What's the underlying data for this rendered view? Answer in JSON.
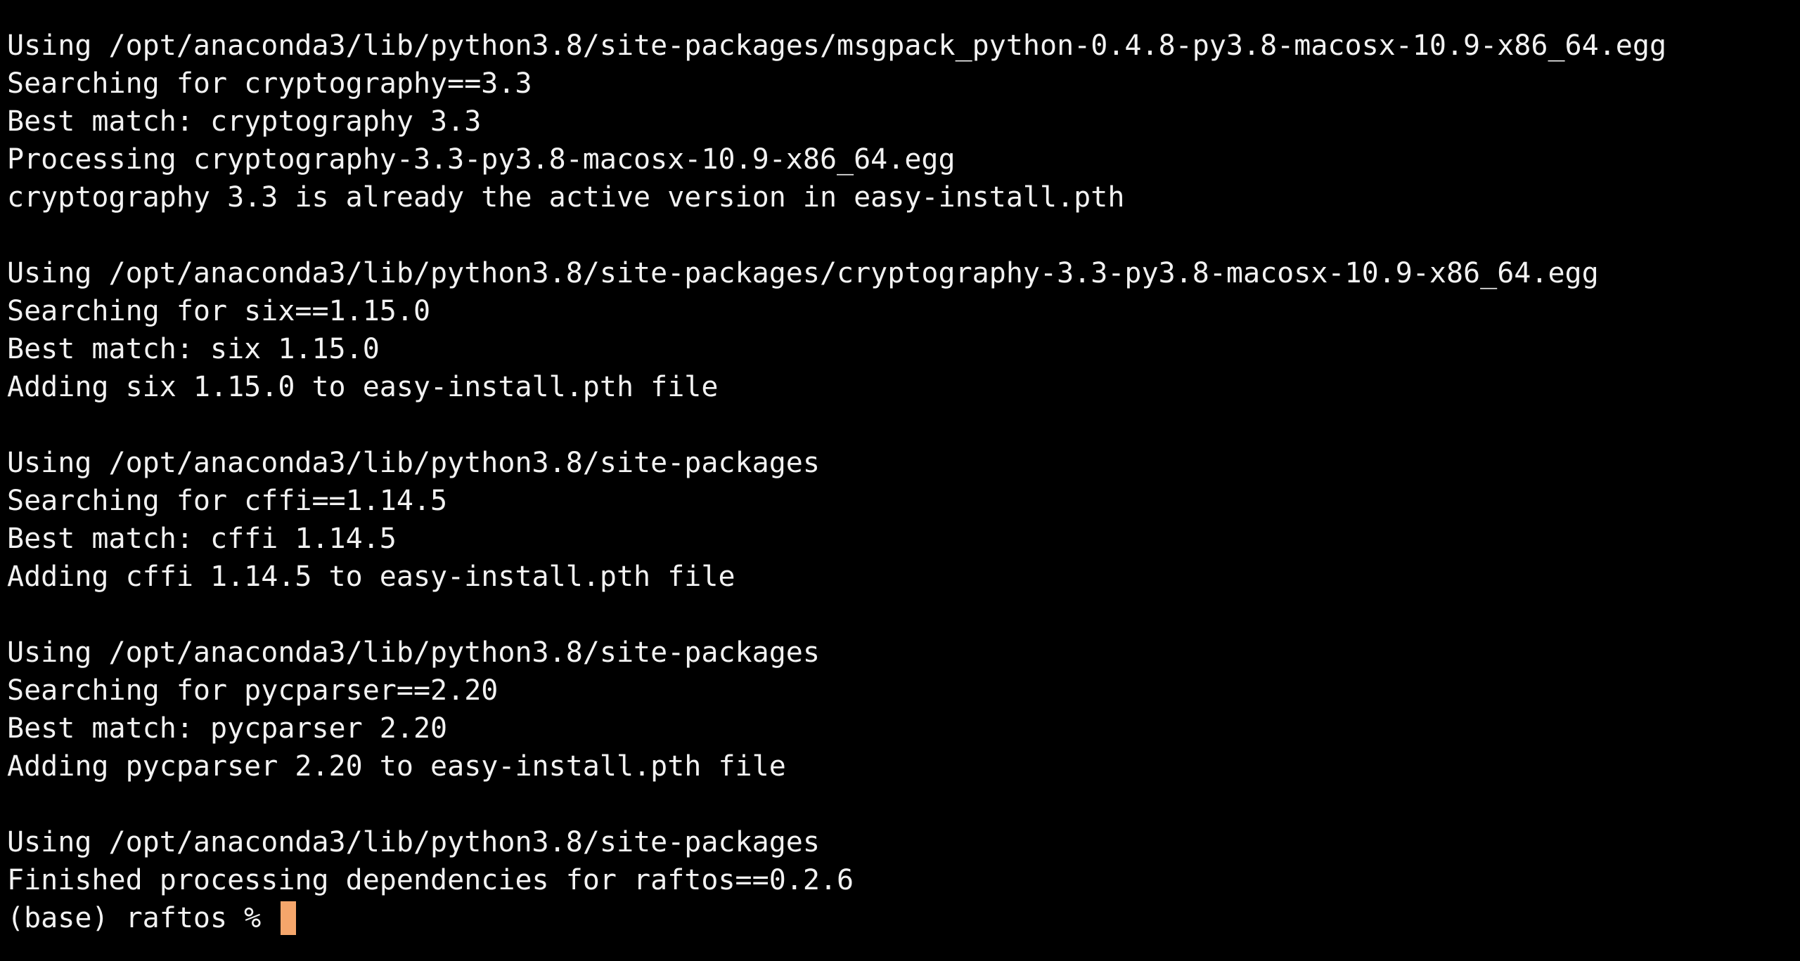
{
  "terminal": {
    "lines": [
      "Using /opt/anaconda3/lib/python3.8/site-packages/msgpack_python-0.4.8-py3.8-macosx-10.9-x86_64.egg",
      "Searching for cryptography==3.3",
      "Best match: cryptography 3.3",
      "Processing cryptography-3.3-py3.8-macosx-10.9-x86_64.egg",
      "cryptography 3.3 is already the active version in easy-install.pth",
      "",
      "Using /opt/anaconda3/lib/python3.8/site-packages/cryptography-3.3-py3.8-macosx-10.9-x86_64.egg",
      "Searching for six==1.15.0",
      "Best match: six 1.15.0",
      "Adding six 1.15.0 to easy-install.pth file",
      "",
      "Using /opt/anaconda3/lib/python3.8/site-packages",
      "Searching for cffi==1.14.5",
      "Best match: cffi 1.14.5",
      "Adding cffi 1.14.5 to easy-install.pth file",
      "",
      "Using /opt/anaconda3/lib/python3.8/site-packages",
      "Searching for pycparser==2.20",
      "Best match: pycparser 2.20",
      "Adding pycparser 2.20 to easy-install.pth file",
      "",
      "Using /opt/anaconda3/lib/python3.8/site-packages",
      "Finished processing dependencies for raftos==0.2.6"
    ],
    "prompt": "(base) raftos % ",
    "colors": {
      "background": "#000000",
      "text": "#f2f2f2",
      "cursor": "#f5a66b"
    }
  }
}
